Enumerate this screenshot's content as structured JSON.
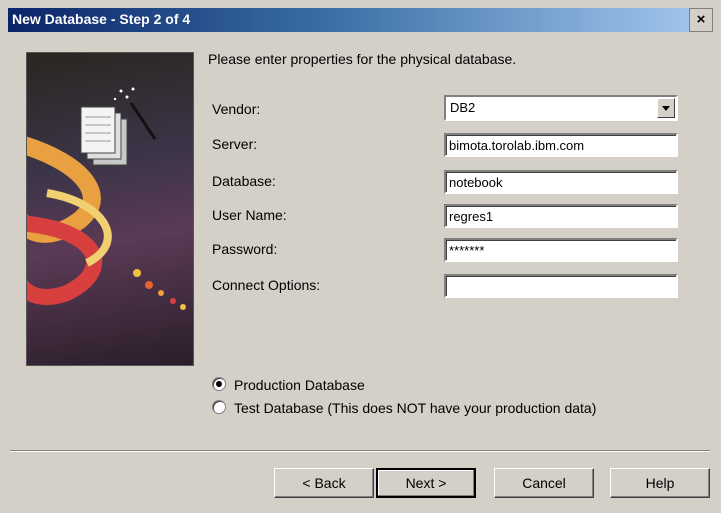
{
  "window": {
    "title": "New Database - Step 2 of 4",
    "close_glyph": "×"
  },
  "intro": "Please enter properties for the physical database.",
  "form": {
    "vendor": {
      "label": "Vendor:",
      "value": "DB2"
    },
    "server": {
      "label": "Server:",
      "value": "bimota.torolab.ibm.com"
    },
    "database": {
      "label": "Database:",
      "value": "notebook"
    },
    "user_name": {
      "label": "User Name:",
      "value": "regres1"
    },
    "password": {
      "label": "Password:",
      "value": "*******"
    },
    "connect_options": {
      "label": "Connect Options:",
      "value": ""
    }
  },
  "database_type": {
    "options": [
      {
        "label": "Production Database",
        "selected": true
      },
      {
        "label": "Test Database (This does NOT have your production data)",
        "selected": false
      }
    ]
  },
  "buttons": {
    "back": "< Back",
    "next": "Next >",
    "cancel": "Cancel",
    "help": "Help"
  }
}
